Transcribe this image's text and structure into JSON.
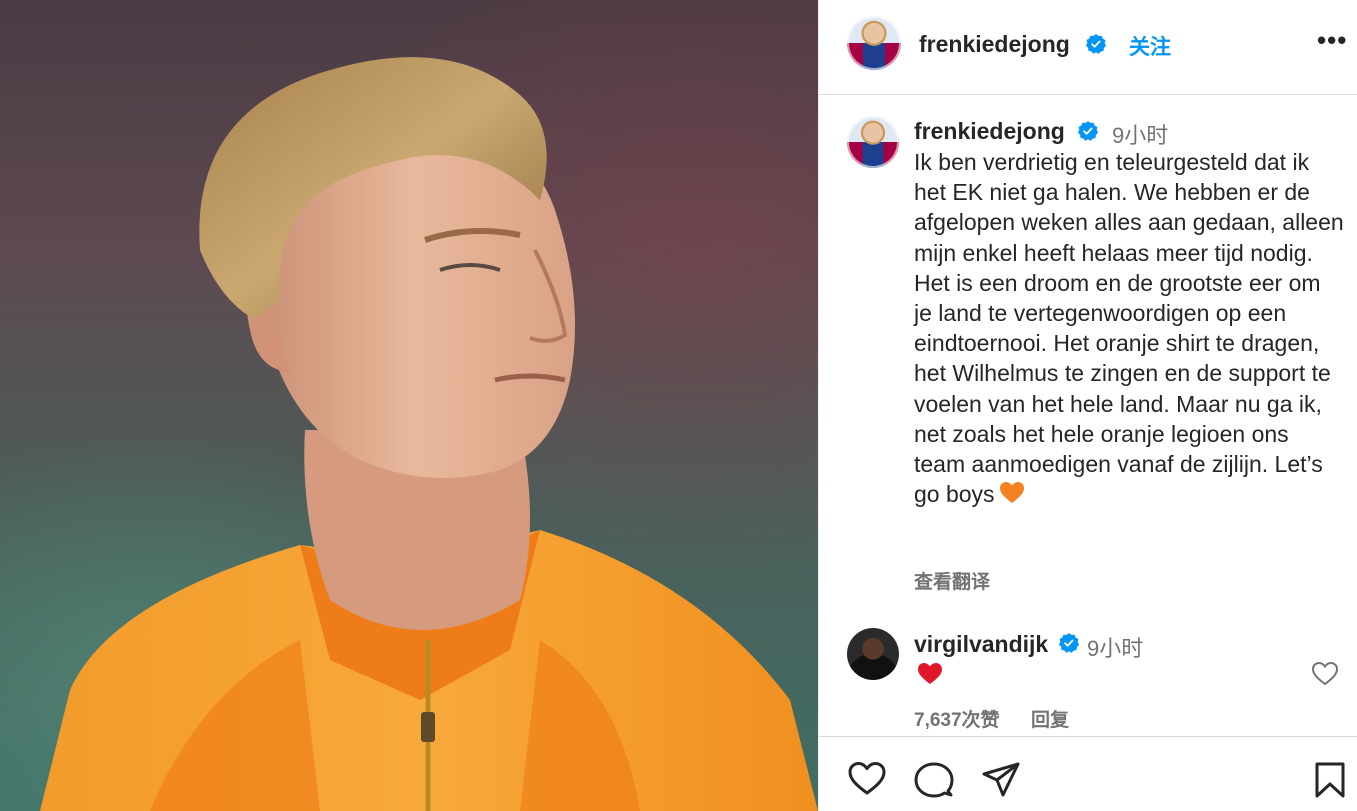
{
  "post": {
    "author": "frenkiedejong",
    "follow_label": "关注",
    "more_label": "•••",
    "caption": {
      "author": "frenkiedejong",
      "time": "9小时",
      "text": "Ik ben verdrietig en teleurgesteld dat ik het EK niet ga halen. We hebben er de afgelopen weken alles aan gedaan, alleen mijn enkel heeft helaas meer tijd nodig. Het is een droom en de grootste eer om je land te vertegenwoordigen op een eindtoernooi. Het oranje shirt te dragen, het Wilhelmus te zingen en de support te voelen van het hele land. Maar nu ga ik, net zoals het hele oranje legioen ons team aanmoedigen vanaf de zijlijn. Let’s go boys",
      "translate_label": "查看翻译"
    },
    "comment": {
      "author": "virgilvandijk",
      "time": "9小时",
      "likes": "7,637次赞",
      "reply_label": "回复"
    }
  },
  "icons": {
    "verified": "verified-badge-icon",
    "heart_orange": "orange-heart-emoji",
    "heart_red": "red-heart-emoji",
    "like": "heart-outline-icon",
    "comment": "speech-bubble-icon",
    "share": "paper-plane-icon",
    "save": "bookmark-icon"
  },
  "colors": {
    "accent": "#0095f6",
    "verified": "#0095f6",
    "muted": "#737373",
    "jersey": "#f28a1c"
  }
}
